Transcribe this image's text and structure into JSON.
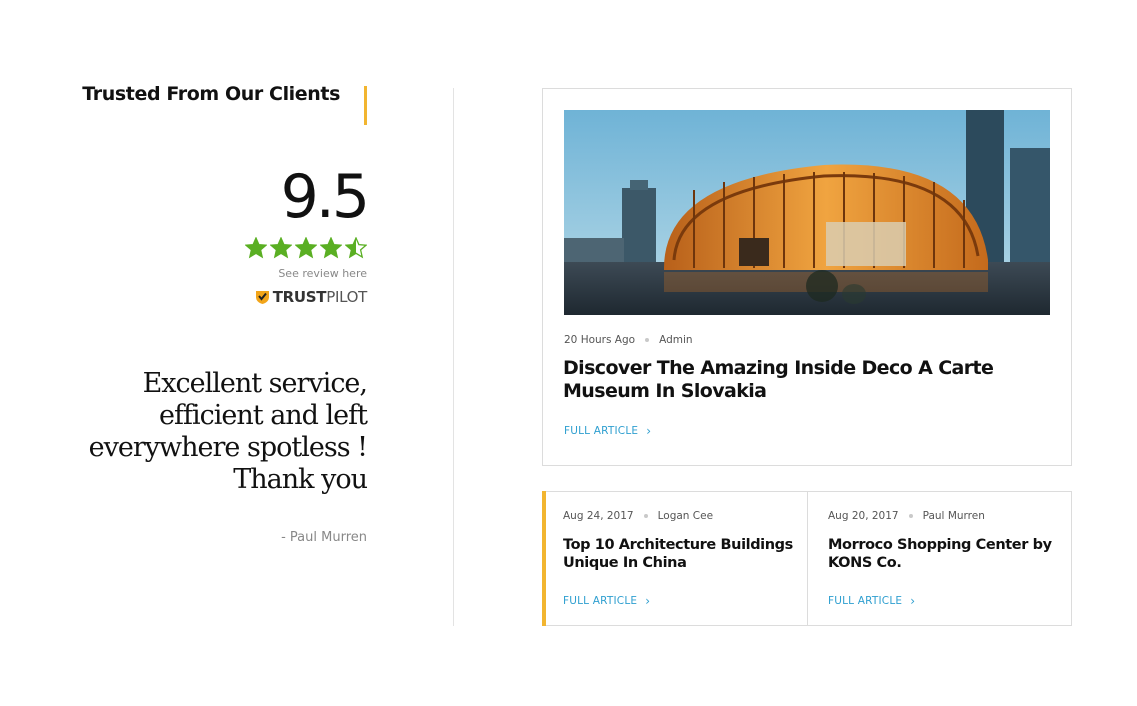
{
  "colors": {
    "accent_yellow": "#f2b530",
    "star_green": "#5aaf23",
    "link_blue": "#2f9fd0"
  },
  "testimonial": {
    "heading": "Trusted From Our Clients",
    "score": "9.5",
    "rating_stars": 4.5,
    "rating_max": 5,
    "review_link": "See review here",
    "trustpilot_bold": "TRUST",
    "trustpilot_light": "PILOT",
    "quote": "Excellent service, efficient and left everywhere spotless ! Thank you",
    "author": "- Paul Murren"
  },
  "featured_article": {
    "time": "20 Hours Ago",
    "author": "Admin",
    "title": "Discover The Amazing Inside Deco A Carte Museum In Slovakia",
    "link": "FULL ARTICLE",
    "image": "curved-wooden-pavilion-photo"
  },
  "articles": [
    {
      "date": "Aug 24, 2017",
      "author": "Logan Cee",
      "title": "Top 10 Architecture Buildings Unique In China",
      "link": "FULL ARTICLE"
    },
    {
      "date": "Aug 20, 2017",
      "author": "Paul Murren",
      "title": "Morroco Shopping Center by KONS Co.",
      "link": "FULL ARTICLE"
    }
  ],
  "icons": {
    "star": "star-icon",
    "half_star": "half-star-icon",
    "trustpilot": "trustpilot-logo-icon",
    "chevron": "chevron-right-icon"
  }
}
